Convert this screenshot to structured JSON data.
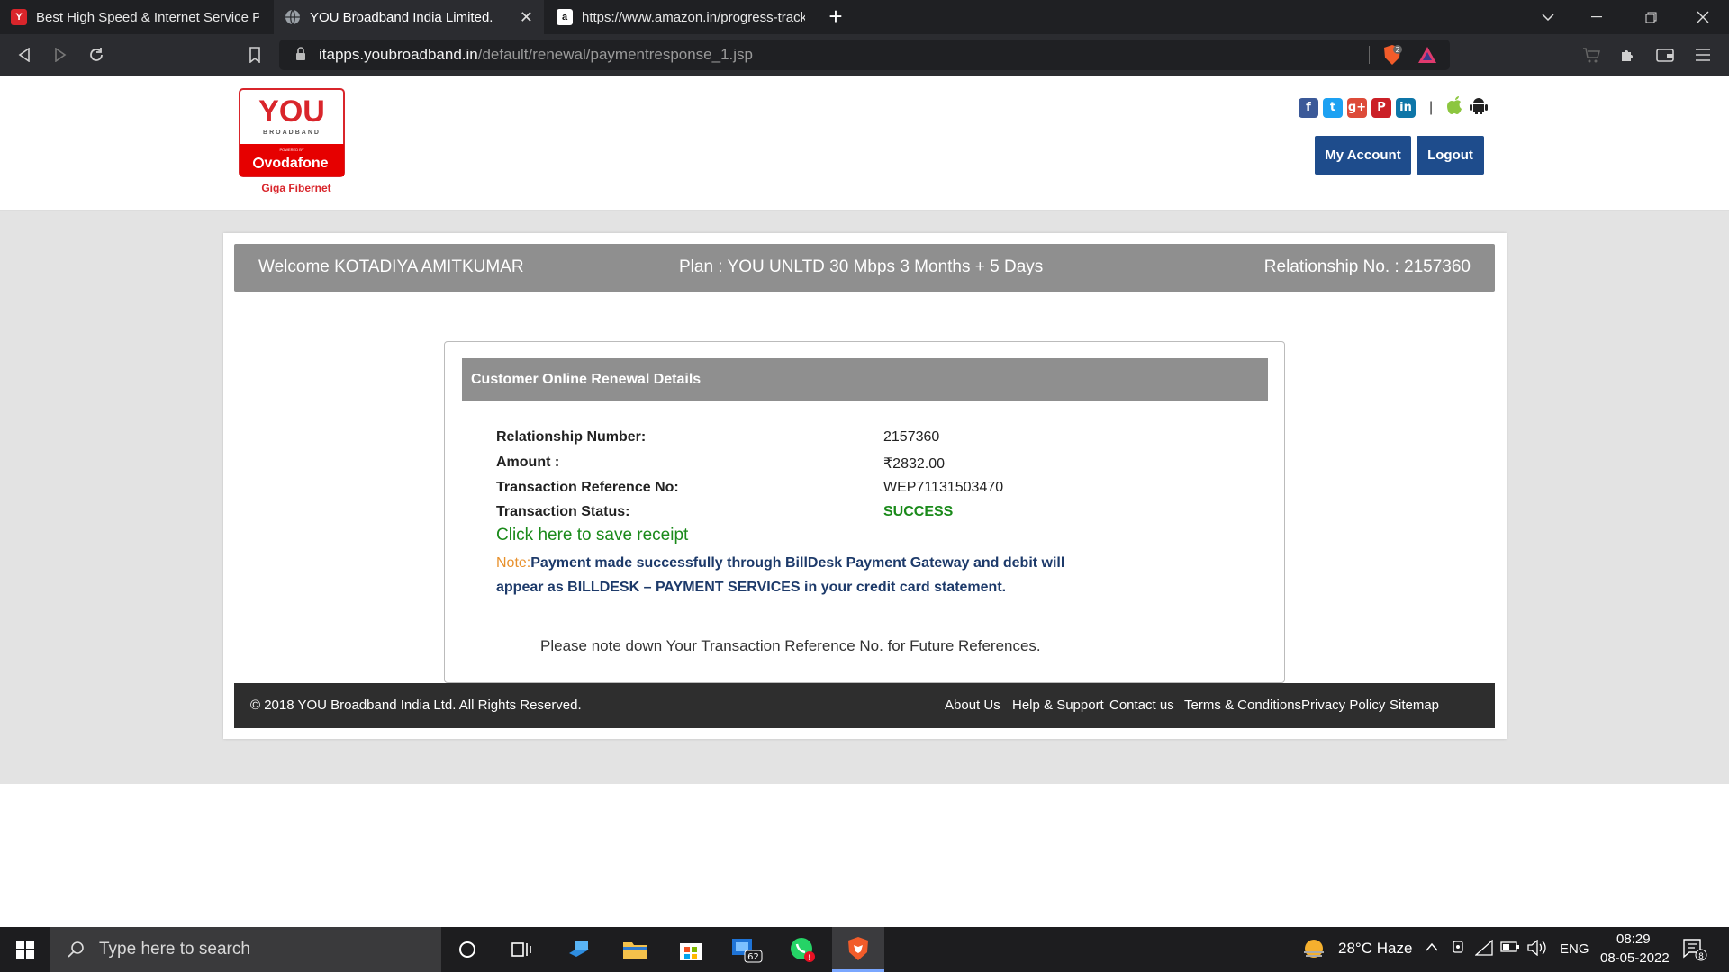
{
  "browser": {
    "tabs": [
      {
        "title": "Best High Speed & Internet Service Pro",
        "favicon": "you-broadband-icon",
        "active": false
      },
      {
        "title": "YOU Broadband India Limited.",
        "favicon": "globe-icon",
        "active": true
      },
      {
        "title": "https://www.amazon.in/progress-track",
        "favicon": "amazon-icon",
        "active": false
      }
    ],
    "new_tab": "+",
    "url_domain": "itapps.youbroadband.in",
    "url_path": "/default/renewal/paymentresponse_1.jsp",
    "shield_badge": "2"
  },
  "site": {
    "logo": {
      "brand": "YOU",
      "sub": "BROADBAND",
      "powered": "POWERED BY",
      "vodafone": "vodafone",
      "giga": "Giga Fibernet"
    },
    "social_icons": [
      "facebook-icon",
      "twitter-icon",
      "google-plus-icon",
      "pinterest-icon",
      "linkedin-icon"
    ],
    "app_icons": [
      "apple-icon",
      "android-icon"
    ],
    "separator": "|",
    "my_account": "My Account",
    "logout": "Logout"
  },
  "welcome_bar": {
    "welcome": "Welcome KOTADIYA AMITKUMAR",
    "plan": "Plan : YOU UNLTD 30 Mbps 3 Months + 5 Days",
    "relationship": "Relationship No. : 2157360"
  },
  "details": {
    "heading": "Customer Online Renewal Details",
    "rows": [
      {
        "label": "Relationship Number:",
        "value": "2157360"
      },
      {
        "label": "Amount :",
        "value": "₹2832.00"
      },
      {
        "label": "Transaction Reference No:",
        "value": "WEP71131503470"
      },
      {
        "label": "Transaction Status:",
        "value": "SUCCESS"
      }
    ],
    "receipt_link": "Click here to save receipt",
    "note_label": "Note:",
    "note_text": "Payment made successfully through BillDesk Payment Gateway and debit will appear as BILLDESK – PAYMENT SERVICES in your credit card statement.",
    "please_note": "Please note down Your Transaction Reference No. for Future References."
  },
  "footer": {
    "copyright": "© 2018 YOU Broadband India Ltd. All Rights Reserved.",
    "links": [
      "About Us",
      "Help & Support",
      "Contact us",
      "Terms & Conditions",
      "Privacy Policy",
      "Sitemap"
    ]
  },
  "taskbar": {
    "search_placeholder": "Type here to search",
    "mail_badge": "62",
    "weather": "28°C  Haze",
    "lang": "ENG",
    "time": "08:29",
    "date": "08-05-2022",
    "notif_badge": "8"
  },
  "colors": {
    "brand_blue": "#1e4c8c",
    "success_green": "#1a8a1a",
    "note_orange": "#e8912d",
    "header_gray": "#8f8f8f"
  }
}
